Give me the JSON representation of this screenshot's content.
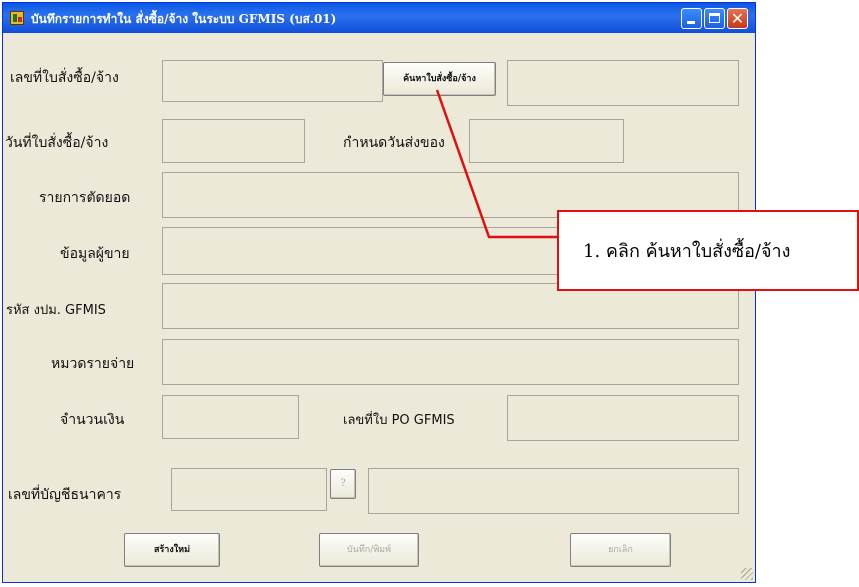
{
  "window": {
    "title": "บันทึกรายการทำใน สั่งซื้อ/จ้าง ในระบบ GFMIS (บส.01)",
    "controls": {
      "minimize_icon": "minimize-icon",
      "maximize_icon": "maximize-icon",
      "close_icon": "close-icon"
    }
  },
  "form": {
    "po_number": {
      "label": "เลขที่ใบสั่งซื้อ/จ้าง",
      "value": "",
      "search_button": "ค้นหาใบสั่งซื้อ/จ้าง",
      "result": ""
    },
    "po_date": {
      "label": "วันที่ใบสั่งซื้อ/จ้าง",
      "value": ""
    },
    "delivery_due": {
      "label": "กำหนดวันส่งของ",
      "value": ""
    },
    "cutoff_items": {
      "label": "รายการตัดยอด",
      "value": ""
    },
    "vendor_info": {
      "label": "ข้อมูลผู้ขาย",
      "value": ""
    },
    "gfmis_budget_code": {
      "label": "รหัส งปม. GFMIS",
      "value": ""
    },
    "expense_category": {
      "label": "หมวดรายจ่าย",
      "value": ""
    },
    "amount": {
      "label": "จำนวนเงิน",
      "value": ""
    },
    "po_gfmis_number": {
      "label": "เลขที่ใบ PO  GFMIS",
      "value": ""
    },
    "bank_account": {
      "label": "เลขที่บัญชีธนาคาร",
      "value": "",
      "help_button": "?",
      "description": ""
    }
  },
  "buttons": {
    "new": "สร้างใหม่",
    "save_print": "บันทึก/พิมพ์",
    "cancel": "ยกเลิก"
  },
  "annotation": {
    "text": "1. คลิก ค้นหาใบสั่งซื้อ/จ้าง",
    "color": "#e01010"
  }
}
